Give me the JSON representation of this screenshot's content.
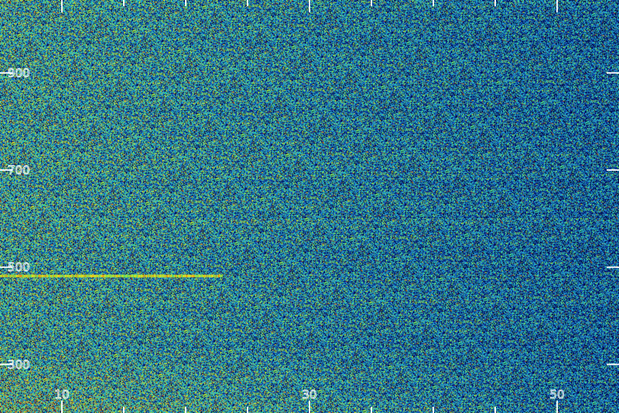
{
  "chart_data": {
    "type": "heatmap",
    "title": "",
    "xlabel": "",
    "ylabel": "",
    "xlim": [
      5,
      55
    ],
    "ylim": [
      200,
      1050
    ],
    "x_major_ticks": [
      10,
      30,
      50
    ],
    "x_major_tick_labels": [
      "10",
      "30",
      "50"
    ],
    "x_minor_ticks": [
      0,
      15,
      20,
      25,
      35,
      40,
      45
    ],
    "y_major_ticks": [
      300,
      500,
      700,
      900
    ],
    "y_major_tick_labels": [
      "300",
      "500",
      "700",
      "900"
    ],
    "colormap": [
      "#00003a",
      "#0a2a8c",
      "#1c5cc8",
      "#1ea0d8",
      "#20d0c0",
      "#80e040",
      "#f0e020",
      "#e04010"
    ],
    "background_color": "#000000",
    "tick_color": "#ffffff",
    "features": [
      {
        "kind": "horizontal-line",
        "y": 482,
        "x_start": 5,
        "x_end": 23,
        "intensity": 0.95
      }
    ],
    "intensity_profile": {
      "left_intensity": 0.55,
      "right_intensity": 0.35,
      "low_band_boost_below": 330
    }
  }
}
